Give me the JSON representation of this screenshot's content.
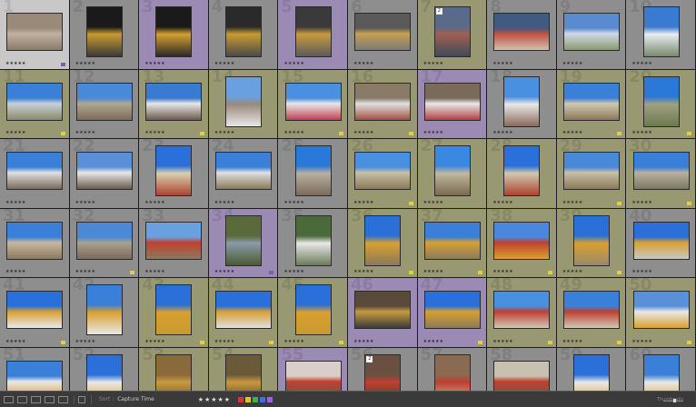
{
  "toolbar": {
    "sort_label": "Sort :",
    "sort_value": "Capture Time",
    "stars": "★★★★★",
    "thumbnails_label": "Thumbnails",
    "colors": [
      "#e03030",
      "#e0c030",
      "#40b040",
      "#4070e0",
      "#a060e0"
    ]
  },
  "grid": {
    "columns": 10,
    "rows": [
      [
        {
          "n": "1",
          "bg": "#c8c8c8",
          "p": [
            "#9a8a7a",
            "#c0b2a0",
            "#8a7a6a"
          ],
          "o": "h",
          "rating": "★★★★★",
          "flag": "#7a5fb0"
        },
        {
          "n": "2",
          "bg": "#8e8e8e",
          "p": [
            "#1a1a1a",
            "#c89a30",
            "#3a3a3a"
          ],
          "o": "v",
          "rating": "★★★★★"
        },
        {
          "n": "3",
          "bg": "#9b8bb4",
          "p": [
            "#1a1a1a",
            "#d4a030",
            "#2a2a2a"
          ],
          "o": "v",
          "rating": "★★★★★"
        },
        {
          "n": "4",
          "bg": "#8e8e8e",
          "p": [
            "#2a2a2a",
            "#c89a30",
            "#4a4a4a"
          ],
          "o": "v",
          "rating": "★★★★★"
        },
        {
          "n": "5",
          "bg": "#9b8bb4",
          "p": [
            "#3a3a3a",
            "#c89a40",
            "#5a5a5a"
          ],
          "o": "v",
          "rating": "★★★★★"
        },
        {
          "n": "6",
          "bg": "#8e8e8e",
          "p": [
            "#5a5a5a",
            "#c8a050",
            "#7a7a7a"
          ],
          "o": "h",
          "rating": "★★★★★"
        },
        {
          "n": "7",
          "bg": "#989872",
          "p": [
            "#5a6a8a",
            "#a06050",
            "#404a5a"
          ],
          "o": "v",
          "rating": "★★★★★",
          "badge": "2"
        },
        {
          "n": "8",
          "bg": "#8e8e8e",
          "p": [
            "#405a80",
            "#c05040",
            "#d0c0b0"
          ],
          "o": "h",
          "rating": "★★★★★"
        },
        {
          "n": "9",
          "bg": "#8e8e8e",
          "p": [
            "#5a8ad0",
            "#d0d8e8",
            "#8a9a70"
          ],
          "o": "h",
          "rating": "★★★★★"
        },
        {
          "n": "10",
          "bg": "#8e8e8e",
          "p": [
            "#3a7ad0",
            "#e8ecf0",
            "#7a8a70"
          ],
          "o": "v",
          "rating": "★★★★★"
        }
      ],
      [
        {
          "n": "11",
          "bg": "#989872",
          "p": [
            "#3a80d8",
            "#c8d0d8",
            "#8a8a6a"
          ],
          "o": "h",
          "rating": "★★★★★",
          "flag": "#e0d040"
        },
        {
          "n": "12",
          "bg": "#8e8e8e",
          "p": [
            "#4a88d8",
            "#b0a890",
            "#7a6a5a"
          ],
          "o": "h",
          "rating": "★★★★★"
        },
        {
          "n": "13",
          "bg": "#989872",
          "p": [
            "#3a7ad0",
            "#e8e8e8",
            "#6a5a4a"
          ],
          "o": "h",
          "rating": "★★★★★",
          "flag": "#e0d040"
        },
        {
          "n": "14",
          "bg": "#989872",
          "p": [
            "#6aa0e0",
            "#9a8a7a",
            "#e8e8e8"
          ],
          "o": "v",
          "rating": "★★★★★"
        },
        {
          "n": "15",
          "bg": "#989872",
          "p": [
            "#4a90e0",
            "#e8e8e8",
            "#c04050"
          ],
          "o": "h",
          "rating": "★★★★★",
          "flag": "#e0d040"
        },
        {
          "n": "16",
          "bg": "#989872",
          "p": [
            "#8a7a6a",
            "#e0e0e0",
            "#a05040"
          ],
          "o": "h",
          "rating": "★★★★★",
          "flag": "#e0d040"
        },
        {
          "n": "17",
          "bg": "#9b8bb4",
          "p": [
            "#7a6a5a",
            "#e8e8e8",
            "#b04040"
          ],
          "o": "h",
          "rating": "★★★★★"
        },
        {
          "n": "18",
          "bg": "#8e8e8e",
          "p": [
            "#4a90e0",
            "#e8e8e8",
            "#8a6a5a"
          ],
          "o": "v",
          "rating": "★★★★★"
        },
        {
          "n": "19",
          "bg": "#989872",
          "p": [
            "#3a80d8",
            "#d0c8b0",
            "#8a7a5a"
          ],
          "o": "h",
          "rating": "★★★★★",
          "flag": "#e0d040"
        },
        {
          "n": "20",
          "bg": "#989872",
          "p": [
            "#2a78d8",
            "#a0a080",
            "#6a7a50"
          ],
          "o": "v",
          "rating": "★★★★★",
          "flag": "#e0d040"
        }
      ],
      [
        {
          "n": "21",
          "bg": "#8e8e8e",
          "p": [
            "#3a80d8",
            "#e0e0e0",
            "#7a6a5a"
          ],
          "o": "h",
          "rating": "★★★★★"
        },
        {
          "n": "22",
          "bg": "#8e8e8e",
          "p": [
            "#5a90d8",
            "#e8e8e8",
            "#6a5a4a"
          ],
          "o": "h",
          "rating": "★★★★★"
        },
        {
          "n": "23",
          "bg": "#8e8e8e",
          "p": [
            "#2a70d8",
            "#d8d0b0",
            "#b04030"
          ],
          "o": "v",
          "rating": "★★★★★"
        },
        {
          "n": "24",
          "bg": "#8e8e8e",
          "p": [
            "#3a80d8",
            "#e0e0e0",
            "#8a7a5a"
          ],
          "o": "h",
          "rating": "★★★★★"
        },
        {
          "n": "25",
          "bg": "#8e8e8e",
          "p": [
            "#2a78d8",
            "#b8b0a0",
            "#7a6a5a"
          ],
          "o": "v",
          "rating": "★★★★★"
        },
        {
          "n": "26",
          "bg": "#989872",
          "p": [
            "#4a90e0",
            "#c8c0a8",
            "#8a7a5a"
          ],
          "o": "h",
          "rating": "★★★★★",
          "flag": "#e0d040"
        },
        {
          "n": "27",
          "bg": "#989872",
          "p": [
            "#3a88e0",
            "#c0b8a0",
            "#7a6a50"
          ],
          "o": "v",
          "rating": "★★★★★"
        },
        {
          "n": "28",
          "bg": "#989872",
          "p": [
            "#2a70d8",
            "#d0c8b0",
            "#b04030"
          ],
          "o": "v",
          "rating": "★★★★★"
        },
        {
          "n": "29",
          "bg": "#989872",
          "p": [
            "#4a88d8",
            "#c8c0a8",
            "#8a7a5a"
          ],
          "o": "h",
          "rating": "★★★★★",
          "flag": "#e0d040"
        },
        {
          "n": "30",
          "bg": "#989872",
          "p": [
            "#3a80d8",
            "#b8b0a0",
            "#7a7a60"
          ],
          "o": "h",
          "rating": "★★★★★",
          "flag": "#e0d040"
        }
      ],
      [
        {
          "n": "31",
          "bg": "#8e8e8e",
          "p": [
            "#3a80d8",
            "#c8b8a0",
            "#8a7a60"
          ],
          "o": "h",
          "rating": "★★★★★"
        },
        {
          "n": "32",
          "bg": "#8e8e8e",
          "p": [
            "#4a88d8",
            "#a8a090",
            "#7a6a5a"
          ],
          "o": "h",
          "rating": "★★★★★",
          "flag": "#e0d040"
        },
        {
          "n": "33",
          "bg": "#8e8e8e",
          "p": [
            "#6aa0e0",
            "#c04030",
            "#8a7a60"
          ],
          "o": "h",
          "rating": "★★★★★"
        },
        {
          "n": "34",
          "bg": "#9b8bb4",
          "p": [
            "#5a6a3a",
            "#8a9aa8",
            "#4a5a30"
          ],
          "o": "v",
          "rating": "★★★★★",
          "flag": "#7a5fb0"
        },
        {
          "n": "35",
          "bg": "#8e8e8e",
          "p": [
            "#4a6a3a",
            "#e8e8e8",
            "#6a7a5a"
          ],
          "o": "v",
          "rating": "★★★★★"
        },
        {
          "n": "36",
          "bg": "#989872",
          "p": [
            "#2a70d8",
            "#d8a030",
            "#8a7a5a"
          ],
          "o": "v",
          "rating": "★★★★★",
          "flag": "#e0d040"
        },
        {
          "n": "37",
          "bg": "#989872",
          "p": [
            "#3a80d8",
            "#d8a030",
            "#8a7a60"
          ],
          "o": "h",
          "rating": "★★★★★",
          "flag": "#e0d040"
        },
        {
          "n": "38",
          "bg": "#989872",
          "p": [
            "#4a88e0",
            "#c04030",
            "#d8a030"
          ],
          "o": "h",
          "rating": "★★★★★",
          "flag": "#e0d040"
        },
        {
          "n": "39",
          "bg": "#989872",
          "p": [
            "#2a70d8",
            "#d8a030",
            "#9a8a6a"
          ],
          "o": "v",
          "rating": "★★★★★",
          "flag": "#e0d040"
        },
        {
          "n": "40",
          "bg": "#8e8e8e",
          "p": [
            "#2a70d8",
            "#d8a030",
            "#c8c8c8"
          ],
          "o": "h",
          "rating": "★★★★★"
        }
      ],
      [
        {
          "n": "41",
          "bg": "#8e8e8e",
          "p": [
            "#2a70d8",
            "#d8a030",
            "#e8e8e8"
          ],
          "o": "h",
          "rating": "★★★★★",
          "flag": "#e0d040"
        },
        {
          "n": "42",
          "bg": "#8e8e8e",
          "p": [
            "#3a80d8",
            "#d8a030",
            "#e8e8e8"
          ],
          "o": "v",
          "rating": "★★★★★"
        },
        {
          "n": "43",
          "bg": "#989872",
          "p": [
            "#2a70d8",
            "#d8a030",
            "#c89a30"
          ],
          "o": "v",
          "rating": "★★★★★",
          "flag": "#e0d040"
        },
        {
          "n": "44",
          "bg": "#989872",
          "p": [
            "#2a70d8",
            "#d8a030",
            "#e0e0e0"
          ],
          "o": "h",
          "rating": "★★★★★",
          "flag": "#e0d040"
        },
        {
          "n": "45",
          "bg": "#989872",
          "p": [
            "#2a70d8",
            "#d8a030",
            "#c89a30"
          ],
          "o": "v",
          "rating": "★★★★★",
          "flag": "#e0d040"
        },
        {
          "n": "46",
          "bg": "#9b8bb4",
          "p": [
            "#5a4a3a",
            "#c89a40",
            "#3a3a3a"
          ],
          "o": "h",
          "rating": "★★★★★"
        },
        {
          "n": "47",
          "bg": "#9b8bb4",
          "p": [
            "#2a70d8",
            "#d8a030",
            "#8a7a5a"
          ],
          "o": "h",
          "rating": "★★★★★",
          "flag": "#e0d040"
        },
        {
          "n": "48",
          "bg": "#989872",
          "p": [
            "#4a90e0",
            "#c04030",
            "#d0c8b8"
          ],
          "o": "h",
          "rating": "★★★★★",
          "flag": "#e0d040"
        },
        {
          "n": "49",
          "bg": "#989872",
          "p": [
            "#3a80d8",
            "#c04030",
            "#d0c8b8"
          ],
          "o": "h",
          "rating": "★★★★★",
          "flag": "#e0d040"
        },
        {
          "n": "50",
          "bg": "#989872",
          "p": [
            "#5a90d8",
            "#e8e8e8",
            "#d8a030"
          ],
          "o": "h",
          "rating": "★★★★★",
          "flag": "#e0d040"
        }
      ],
      [
        {
          "n": "51",
          "bg": "#8e8e8e",
          "p": [
            "#3a80d8",
            "#e8e8e8",
            "#d8a030"
          ],
          "o": "h"
        },
        {
          "n": "52",
          "bg": "#8e8e8e",
          "p": [
            "#2a70d8",
            "#e8e8e8",
            "#d8a030"
          ],
          "o": "v"
        },
        {
          "n": "53",
          "bg": "#989872",
          "p": [
            "#8a6a3a",
            "#c89a40",
            "#5a4a30"
          ],
          "o": "v"
        },
        {
          "n": "54",
          "bg": "#989872",
          "p": [
            "#6a5a3a",
            "#c89a40",
            "#4a3a2a"
          ],
          "o": "v"
        },
        {
          "n": "55",
          "bg": "#9b8bb4",
          "p": [
            "#d8d0c8",
            "#c04030",
            "#6a5a4a"
          ],
          "o": "h"
        },
        {
          "n": "56",
          "bg": "#8e8e8e",
          "p": [
            "#6a5040",
            "#c04030",
            "#4a3a30"
          ],
          "o": "v",
          "badge": "2"
        },
        {
          "n": "57",
          "bg": "#8e8e8e",
          "p": [
            "#8a6a50",
            "#c04030",
            "#d0b8a0"
          ],
          "o": "v"
        },
        {
          "n": "58",
          "bg": "#8e8e8e",
          "p": [
            "#c8c0b0",
            "#c04030",
            "#6a5a4a"
          ],
          "o": "h"
        },
        {
          "n": "59",
          "bg": "#8e8e8e",
          "p": [
            "#2a70d8",
            "#e8e8e8",
            "#d8a030"
          ],
          "o": "v"
        },
        {
          "n": "60",
          "bg": "#8e8e8e",
          "p": [
            "#3a80d8",
            "#e8e8e8",
            "#d8a030"
          ],
          "o": "v"
        }
      ]
    ]
  }
}
